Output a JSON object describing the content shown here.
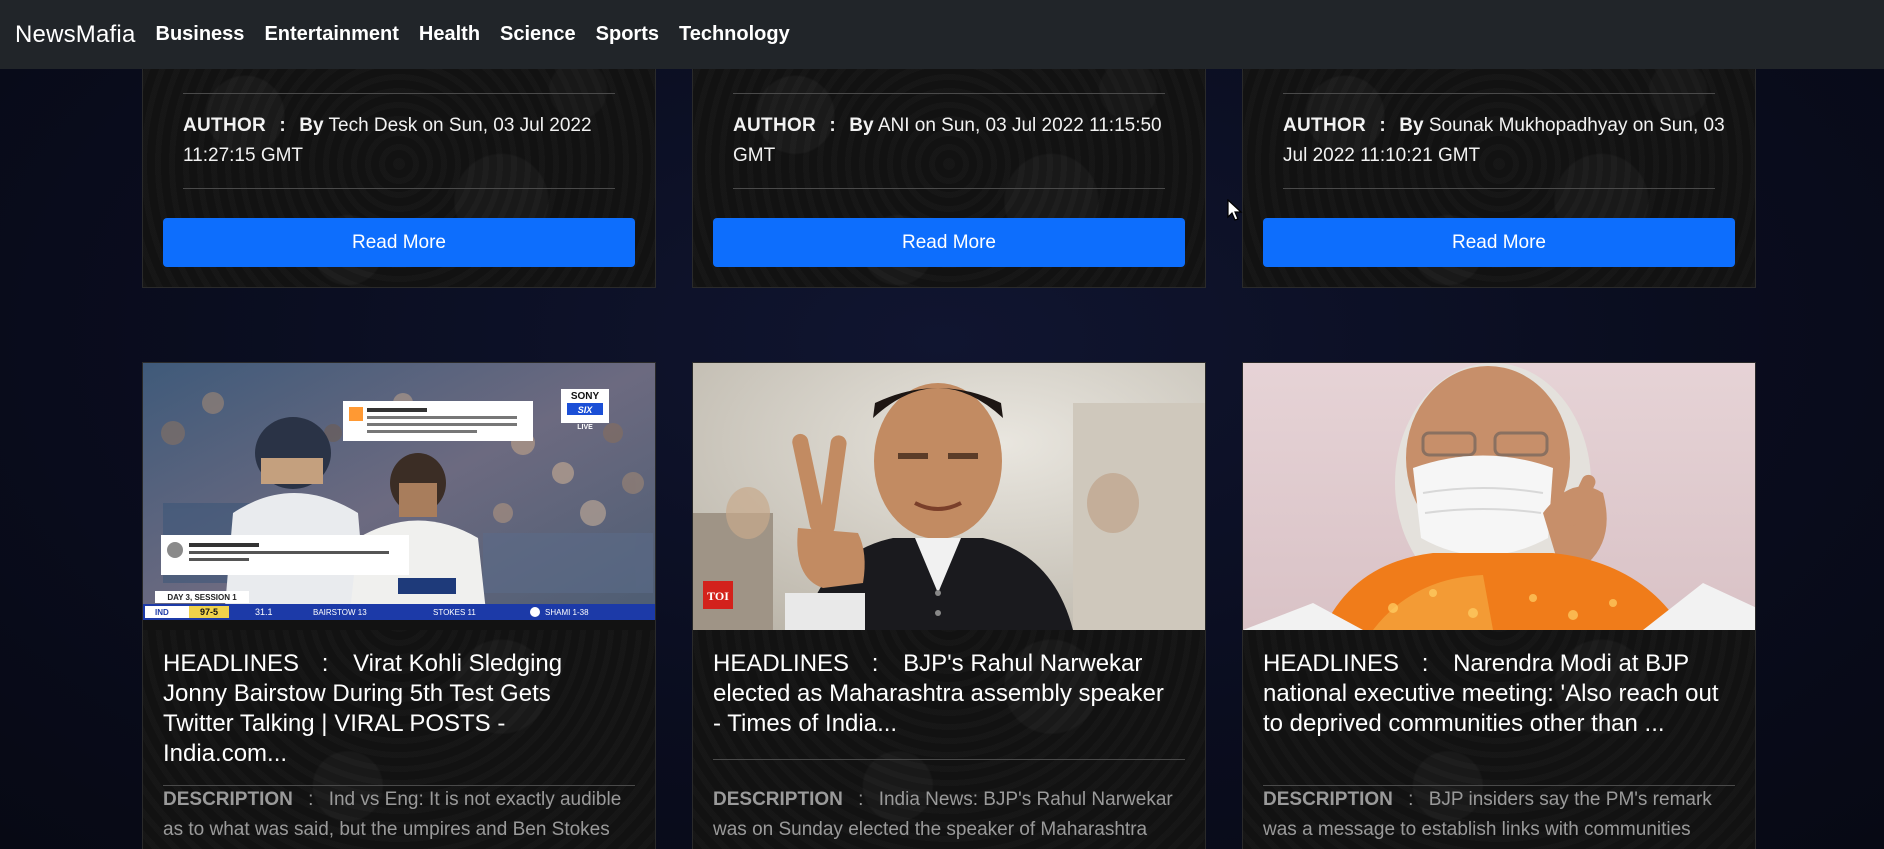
{
  "navbar": {
    "brand": "NewsMafia",
    "links": [
      "Business",
      "Entertainment",
      "Health",
      "Science",
      "Sports",
      "Technology"
    ]
  },
  "top_cards": [
    {
      "author_label": "AUTHOR",
      "separator": ":",
      "by": "By",
      "author_text": "Tech Desk on Sun, 03 Jul 2022 11:27:15 GMT",
      "button": "Read More"
    },
    {
      "author_label": "AUTHOR",
      "separator": ":",
      "by": "By",
      "author_text": "ANI on Sun, 03 Jul 2022 11:15:50 GMT",
      "button": "Read More"
    },
    {
      "author_label": "AUTHOR",
      "separator": ":",
      "by": "By",
      "author_text": "Sounak Mukhopadhyay on Sun, 03 Jul 2022 11:10:21 GMT",
      "button": "Read More"
    }
  ],
  "bottom_cards": [
    {
      "headline_label": "HEADLINES",
      "separator": ":",
      "headline": "Virat Kohli Sledging Jonny Bairstow During 5th Test Gets Twitter Talking | VIRAL POSTS - India.com...",
      "description_label": "DESCRIPTION",
      "description": "Ind vs Eng: It is not exactly audible as to what was said, but the umpires and Ben Stokes",
      "image_overlay": {
        "broadcaster_top": "SONY",
        "broadcaster_mid": "SIX",
        "broadcaster_bottom": "LIVE",
        "session": "DAY 3, SESSION 1",
        "score_team": "IND",
        "score": "97-5",
        "overs": "31.1",
        "batter1": "BAIRSTOW 13",
        "batter2": "STOKES 11",
        "bowler": "SHAMI 1-38"
      }
    },
    {
      "headline_label": "HEADLINES",
      "separator": ":",
      "headline": "BJP's Rahul Narwekar elected as Maharashtra assembly speaker - Times of India...",
      "description_label": "DESCRIPTION",
      "description": "India News: BJP's Rahul Narwekar was on Sunday elected the speaker of Maharashtra",
      "image_overlay": {
        "logo": "TOI"
      }
    },
    {
      "headline_label": "HEADLINES",
      "separator": ":",
      "headline": "Narendra Modi at BJP national executive meeting: 'Also reach out to deprived communities other than ...",
      "description_label": "DESCRIPTION",
      "description": "BJP insiders say the PM's remark was a message to establish links with communities"
    }
  ],
  "colors": {
    "navbar_bg": "#212529",
    "page_bg": "#0b0d1d",
    "button_primary": "#0d6efd"
  }
}
